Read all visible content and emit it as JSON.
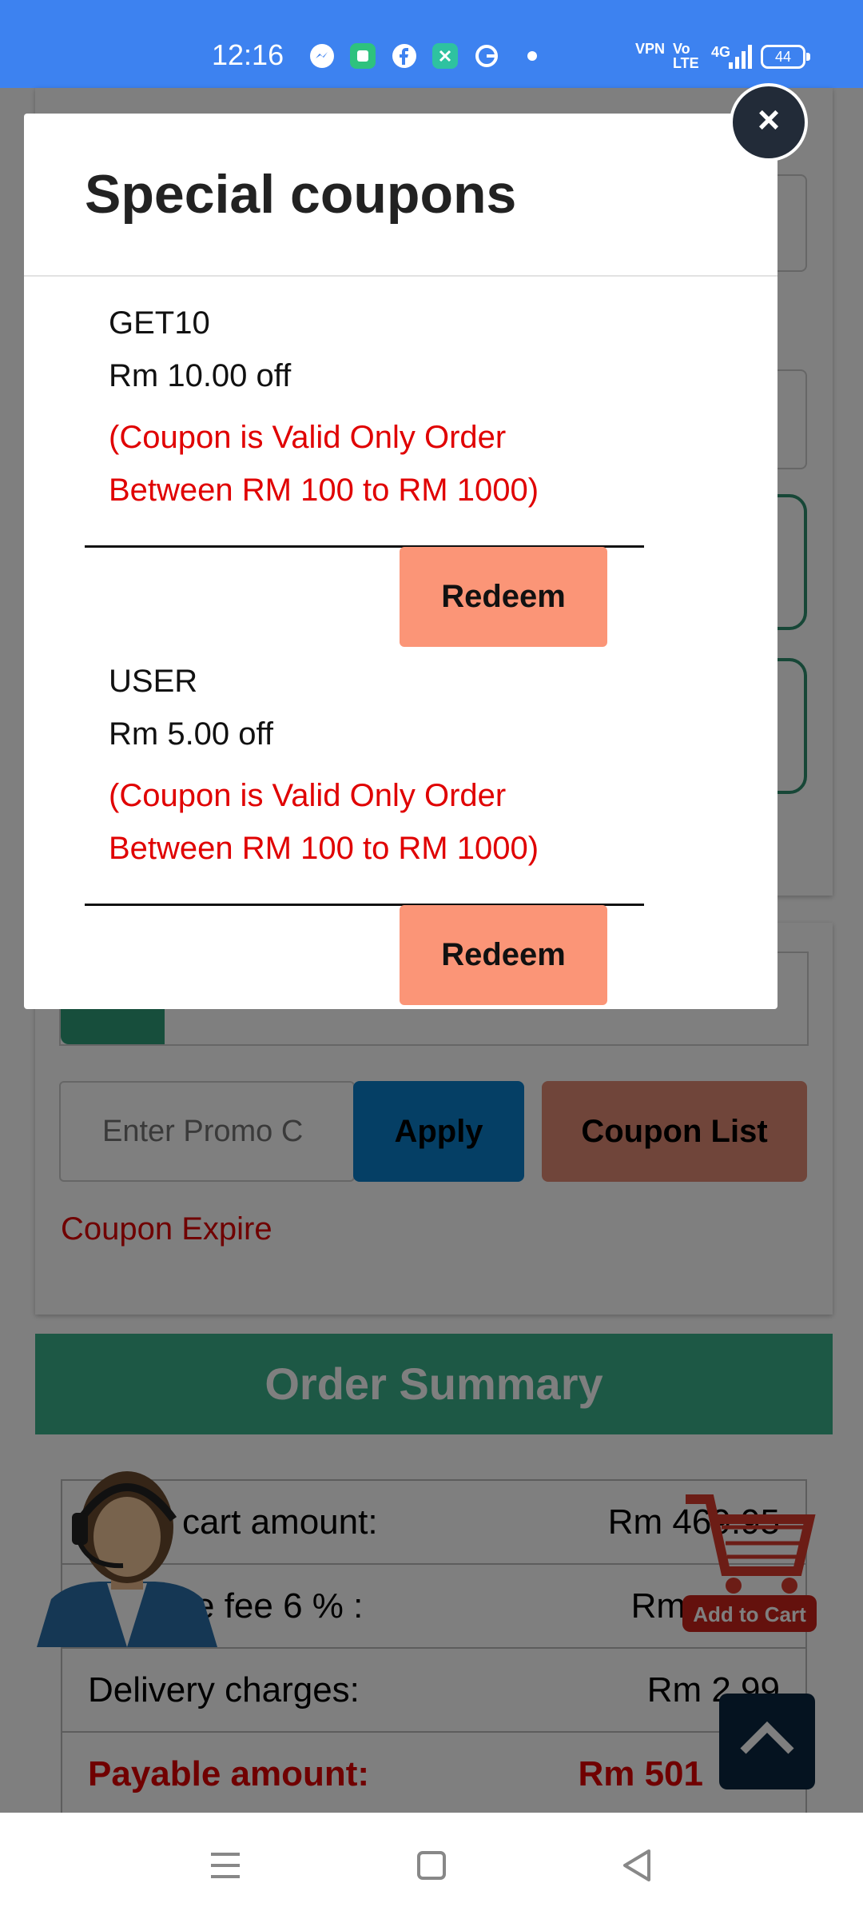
{
  "status_bar": {
    "time": "12:16",
    "icons": [
      "messenger-icon",
      "app-icon",
      "facebook-icon",
      "app-icon",
      "google-icon",
      "dot-icon"
    ],
    "vpn": "VPN",
    "volte": "Vo LTE",
    "network": "4G",
    "battery": "44"
  },
  "modal": {
    "title": "Special coupons",
    "close_label": "×",
    "coupons": [
      {
        "code": "GET10",
        "amount": "Rm 10.00 off",
        "condition": "(Coupon is Valid Only Order Between RM 100 to RM 1000)",
        "redeem_label": "Redeem"
      },
      {
        "code": "USER",
        "amount": "Rm 5.00 off",
        "condition": "(Coupon is Valid Only Order Between RM 100 to RM 1000)",
        "redeem_label": "Redeem"
      }
    ]
  },
  "promo": {
    "placeholder": "Enter Promo C",
    "apply_label": "Apply",
    "coupon_list_label": "Coupon List",
    "status": "Coupon Expire"
  },
  "order_summary": {
    "title": "Order Summary",
    "rows": [
      {
        "label": "cart amount:",
        "value": "Rm 469.95"
      },
      {
        "label": "e fee 6 % :",
        "value": "Rm"
      },
      {
        "label": "Delivery charges:",
        "value": "Rm 2.99"
      },
      {
        "label": "Payable amount:",
        "value": "Rm 501"
      }
    ]
  },
  "floating": {
    "cart_label": "Add to Cart"
  },
  "nav_bar": {
    "icons": [
      "menu-icon",
      "home-icon",
      "back-icon"
    ]
  },
  "colors": {
    "status_bar": "#3d82f0",
    "accent_green": "#3ab18b",
    "coupon_red": "#e00000",
    "redeem_bg": "#fb9577",
    "apply_blue": "#0a7ecb"
  }
}
